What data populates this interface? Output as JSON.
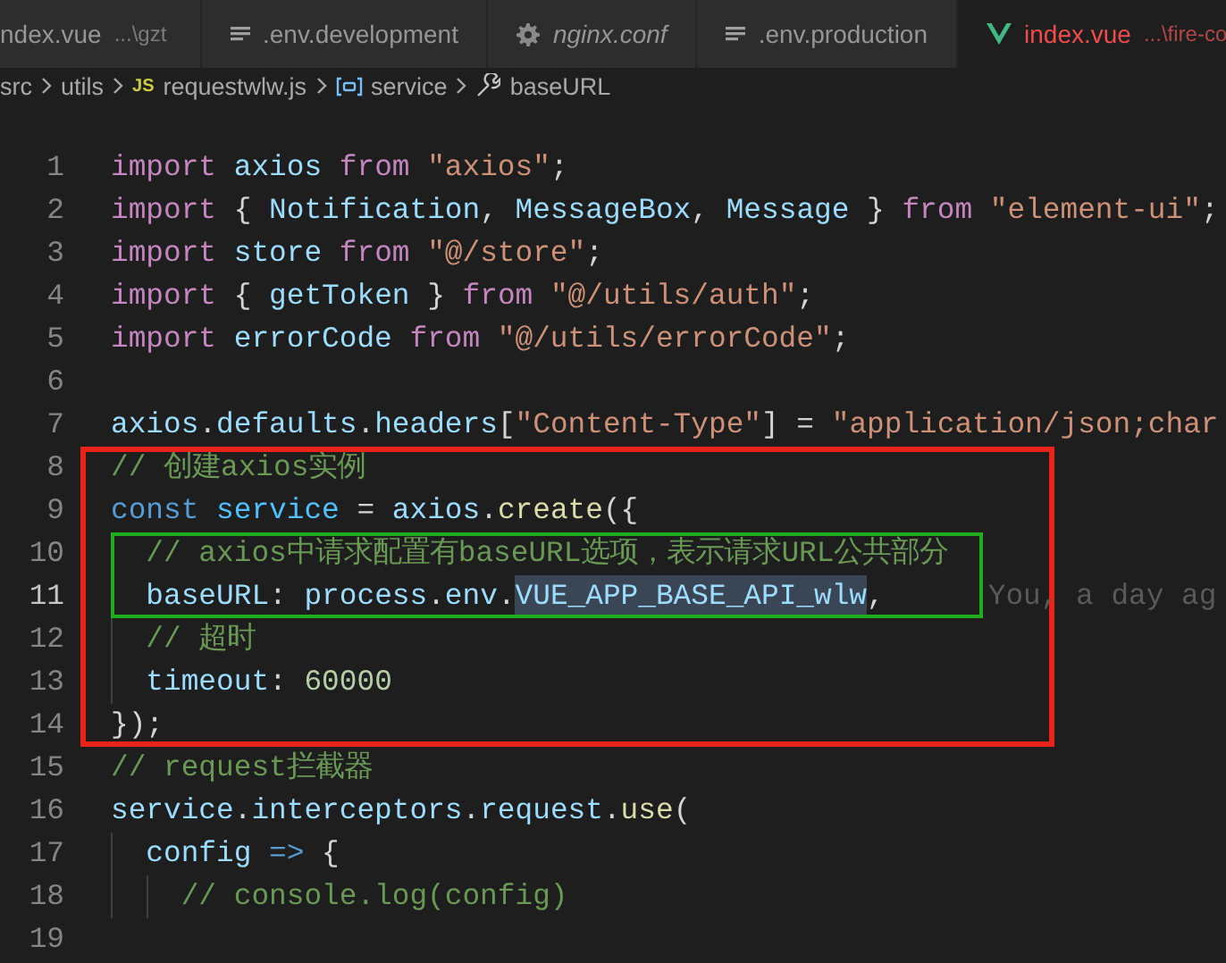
{
  "tabs": [
    {
      "kind": "plain",
      "label": "ndex.vue",
      "description": "...\\gzt",
      "preview": false,
      "error": false,
      "selected": false
    },
    {
      "kind": "text",
      "label": ".env.development",
      "preview": false,
      "error": false,
      "selected": false
    },
    {
      "kind": "config",
      "label": "nginx.conf",
      "preview": true,
      "error": false,
      "selected": false
    },
    {
      "kind": "text",
      "label": ".env.production",
      "preview": false,
      "error": false,
      "selected": false
    },
    {
      "kind": "vue",
      "label": "index.vue",
      "description": "...\\fire-co",
      "preview": false,
      "error": true,
      "selected": true
    }
  ],
  "breadcrumb": [
    {
      "kind": "folder",
      "text": "src"
    },
    {
      "kind": "folder",
      "text": "utils"
    },
    {
      "kind": "file",
      "badge": "JS",
      "text": "requestwlw.js"
    },
    {
      "kind": "variable",
      "text": "service"
    },
    {
      "kind": "property",
      "text": "baseURL"
    }
  ],
  "code": [
    {
      "kind": "line",
      "number": "1",
      "current": false,
      "tokens": [
        {
          "kind": "keyword",
          "text": "import "
        },
        {
          "kind": "variable",
          "text": "axios "
        },
        {
          "kind": "keyword",
          "text": "from "
        },
        {
          "kind": "string",
          "text": "\"axios\""
        },
        {
          "kind": "punct",
          "text": ";"
        }
      ]
    },
    {
      "kind": "line",
      "number": "2",
      "current": false,
      "tokens": [
        {
          "kind": "keyword",
          "text": "import "
        },
        {
          "kind": "punct",
          "text": "{ "
        },
        {
          "kind": "variable",
          "text": "Notification"
        },
        {
          "kind": "punct",
          "text": ", "
        },
        {
          "kind": "variable",
          "text": "MessageBox"
        },
        {
          "kind": "punct",
          "text": ", "
        },
        {
          "kind": "variable",
          "text": "Message"
        },
        {
          "kind": "punct",
          "text": " } "
        },
        {
          "kind": "keyword",
          "text": "from "
        },
        {
          "kind": "string",
          "text": "\"element-ui\""
        },
        {
          "kind": "punct",
          "text": ";"
        }
      ]
    },
    {
      "kind": "line",
      "number": "3",
      "current": false,
      "tokens": [
        {
          "kind": "keyword",
          "text": "import "
        },
        {
          "kind": "variable",
          "text": "store "
        },
        {
          "kind": "keyword",
          "text": "from "
        },
        {
          "kind": "string",
          "text": "\"@/store\""
        },
        {
          "kind": "punct",
          "text": ";"
        }
      ]
    },
    {
      "kind": "line",
      "number": "4",
      "current": false,
      "tokens": [
        {
          "kind": "keyword",
          "text": "import "
        },
        {
          "kind": "punct",
          "text": "{ "
        },
        {
          "kind": "variable",
          "text": "getToken"
        },
        {
          "kind": "punct",
          "text": " } "
        },
        {
          "kind": "keyword",
          "text": "from "
        },
        {
          "kind": "string",
          "text": "\"@/utils/auth\""
        },
        {
          "kind": "punct",
          "text": ";"
        }
      ]
    },
    {
      "kind": "line",
      "number": "5",
      "current": false,
      "tokens": [
        {
          "kind": "keyword",
          "text": "import "
        },
        {
          "kind": "variable",
          "text": "errorCode "
        },
        {
          "kind": "keyword",
          "text": "from "
        },
        {
          "kind": "string",
          "text": "\"@/utils/errorCode\""
        },
        {
          "kind": "punct",
          "text": ";"
        }
      ]
    },
    {
      "kind": "line",
      "number": "6",
      "current": false
    },
    {
      "kind": "line",
      "number": "7",
      "current": false,
      "tokens": [
        {
          "kind": "variable",
          "text": "axios"
        },
        {
          "kind": "punct",
          "text": "."
        },
        {
          "kind": "variable",
          "text": "defaults"
        },
        {
          "kind": "punct",
          "text": "."
        },
        {
          "kind": "variable",
          "text": "headers"
        },
        {
          "kind": "punct",
          "text": "["
        },
        {
          "kind": "string",
          "text": "\"Content-Type\""
        },
        {
          "kind": "punct",
          "text": "] = "
        },
        {
          "kind": "string",
          "text": "\"application/json;char"
        }
      ]
    },
    {
      "kind": "frame",
      "color": "#e8231a",
      "items": [
        {
          "kind": "line",
          "number": "8",
          "current": false,
          "tokens": [
            {
              "kind": "comment",
              "text": "// 创建axios实例"
            }
          ]
        },
        {
          "kind": "line",
          "number": "9",
          "current": false,
          "tokens": [
            {
              "kind": "storage",
              "text": "const "
            },
            {
              "kind": "constant",
              "text": "service"
            },
            {
              "kind": "punct",
              "text": " = "
            },
            {
              "kind": "variable",
              "text": "axios"
            },
            {
              "kind": "punct",
              "text": "."
            },
            {
              "kind": "function",
              "text": "create"
            },
            {
              "kind": "punct",
              "text": "({"
            }
          ]
        },
        {
          "kind": "frame",
          "color": "#1fad1f",
          "items": [
            {
              "kind": "line",
              "number": "10",
              "current": false,
              "tokens": [
                {
                  "kind": "comment",
                  "text": "  // axios中请求配置有baseURL选项，表示请求URL公共部分"
                }
              ]
            },
            {
              "kind": "line",
              "number": "11",
              "current": true,
              "tokens": [
                {
                  "kind": "variable",
                  "text": "  baseURL"
                },
                {
                  "kind": "punct",
                  "text": ": "
                },
                {
                  "kind": "variable",
                  "text": "process"
                },
                {
                  "kind": "punct",
                  "text": "."
                },
                {
                  "kind": "variable",
                  "text": "env"
                },
                {
                  "kind": "punct",
                  "text": "."
                },
                {
                  "kind": "selection",
                  "text": "VUE_APP_BASE_API_wlw"
                },
                {
                  "kind": "punct",
                  "text": ","
                },
                {
                  "kind": "blame",
                  "text": "You, a day ag"
                }
              ]
            }
          ]
        },
        {
          "kind": "line",
          "number": "12",
          "current": false,
          "tokens": [
            {
              "kind": "comment",
              "text": "  // 超时"
            }
          ]
        },
        {
          "kind": "line",
          "number": "13",
          "current": false,
          "tokens": [
            {
              "kind": "variable",
              "text": "  timeout"
            },
            {
              "kind": "punct",
              "text": ": "
            },
            {
              "kind": "number",
              "text": "60000"
            }
          ]
        },
        {
          "kind": "line",
          "number": "14",
          "current": false,
          "tokens": [
            {
              "kind": "punct",
              "text": "});"
            }
          ]
        }
      ]
    },
    {
      "kind": "line",
      "number": "15",
      "current": false,
      "tokens": [
        {
          "kind": "comment",
          "text": "// request拦截器"
        }
      ]
    },
    {
      "kind": "line",
      "number": "16",
      "current": false,
      "tokens": [
        {
          "kind": "variable",
          "text": "service"
        },
        {
          "kind": "punct",
          "text": "."
        },
        {
          "kind": "variable",
          "text": "interceptors"
        },
        {
          "kind": "punct",
          "text": "."
        },
        {
          "kind": "variable",
          "text": "request"
        },
        {
          "kind": "punct",
          "text": "."
        },
        {
          "kind": "function",
          "text": "use"
        },
        {
          "kind": "punct",
          "text": "("
        }
      ]
    },
    {
      "kind": "line",
      "number": "17",
      "current": false,
      "tokens": [
        {
          "kind": "variable",
          "text": "  config "
        },
        {
          "kind": "storage",
          "text": "=> "
        },
        {
          "kind": "punct",
          "text": "{"
        }
      ]
    },
    {
      "kind": "line",
      "number": "18",
      "current": false,
      "tokens": [
        {
          "kind": "comment",
          "text": "    // console.log(config)"
        }
      ]
    },
    {
      "kind": "line",
      "number": "19",
      "current": false
    }
  ]
}
